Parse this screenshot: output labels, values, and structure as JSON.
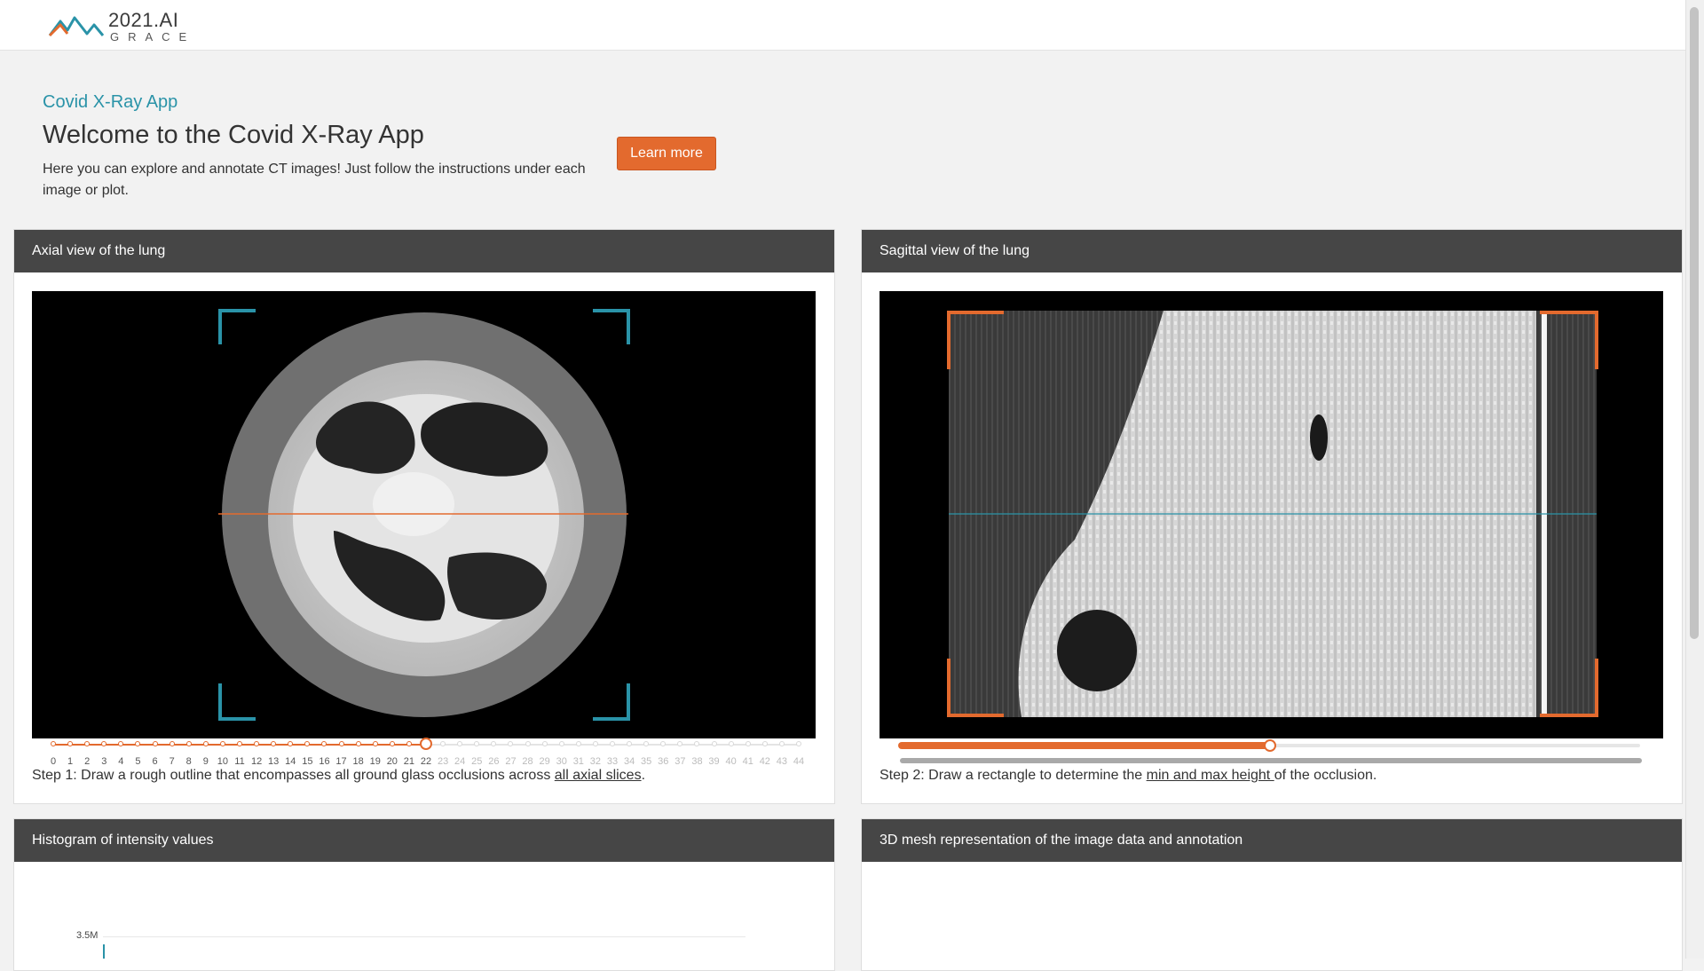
{
  "brand": {
    "name": "2021.AI",
    "product": "GRACE"
  },
  "intro": {
    "crumb": "Covid X-Ray App",
    "title": "Welcome to the Covid X-Ray App",
    "description": "Here you can explore and annotate CT images! Just follow the instructions under each image or plot.",
    "learn_more": "Learn more"
  },
  "panels": {
    "axial": {
      "title": "Axial view of the lung",
      "step_prefix": "Step 1: Draw a rough outline that encompasses all ground glass occlusions across ",
      "step_link": "all axial slices",
      "step_suffix": ".",
      "slider": {
        "min": 0,
        "max": 44,
        "value": 22
      }
    },
    "sagittal": {
      "title": "Sagittal view of the lung",
      "step_prefix": "Step 2: Draw a rectangle to determine the ",
      "step_link": "min and max height ",
      "step_suffix": "of the occlusion.",
      "slider_fraction": 0.5
    },
    "histogram": {
      "title": "Histogram of intensity values",
      "y_tick": "3.5M"
    },
    "mesh": {
      "title": "3D mesh representation of the image data and annotation"
    }
  },
  "colors": {
    "accent": "#e36a2e",
    "teal": "#2a93a8",
    "header_bg": "#464646"
  }
}
